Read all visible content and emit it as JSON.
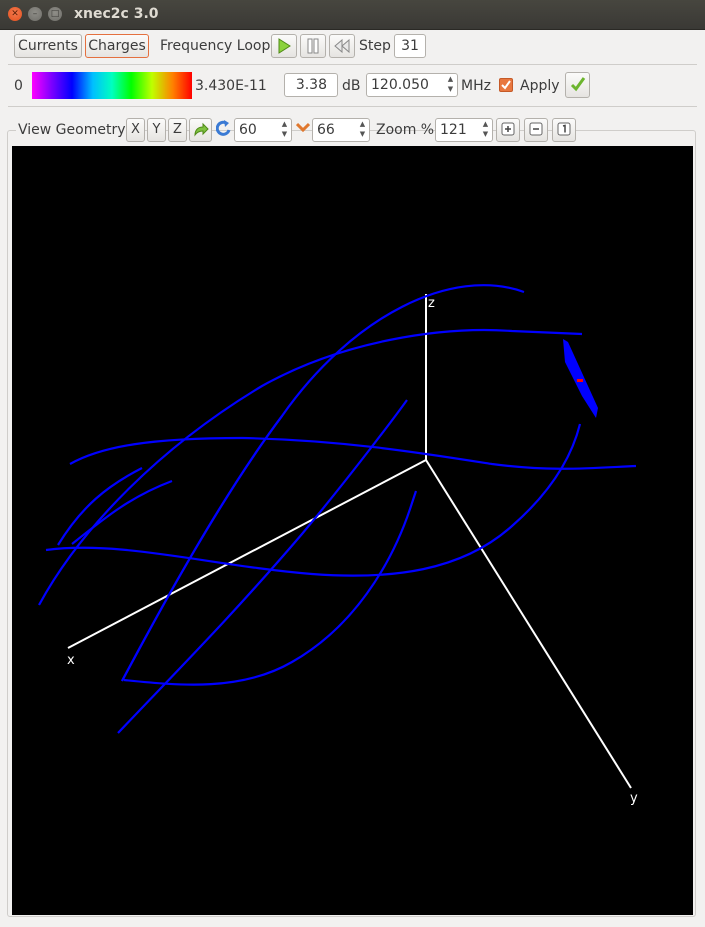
{
  "window": {
    "title": "xnec2c 3.0"
  },
  "toolbar1": {
    "currents_label": "Currents",
    "charges_label": "Charges",
    "frequency_loop_label": "Frequency Loop",
    "step_label": "Step",
    "step_value": "31"
  },
  "toolbar2": {
    "scale_min": "0",
    "scale_max": "3.430E-11",
    "db_value": "3.38",
    "db_unit": "dB",
    "freq_value": "120.050",
    "freq_unit": "MHz",
    "apply_label": "Apply",
    "apply_checked": true
  },
  "view": {
    "label": "View Geometry",
    "x_label": "X",
    "y_label": "Y",
    "z_label": "Z",
    "rot_value": "60",
    "incl_value": "66",
    "zoom_label": "Zoom %",
    "zoom_value": "121"
  },
  "plot": {
    "axis_x": "x",
    "axis_y": "y",
    "axis_z": "z",
    "background": "#000000",
    "wire_color": "#0000ff",
    "axis_color": "#ffffff"
  },
  "icons": [
    "close-icon",
    "minimize-icon",
    "maximize-icon",
    "play-icon",
    "pause-icon",
    "rewind-icon",
    "apply-icon",
    "rotate-icon",
    "rotate-ccw-icon",
    "incline-icon",
    "zoom-in-icon",
    "zoom-out-icon",
    "zoom-reset-icon"
  ]
}
